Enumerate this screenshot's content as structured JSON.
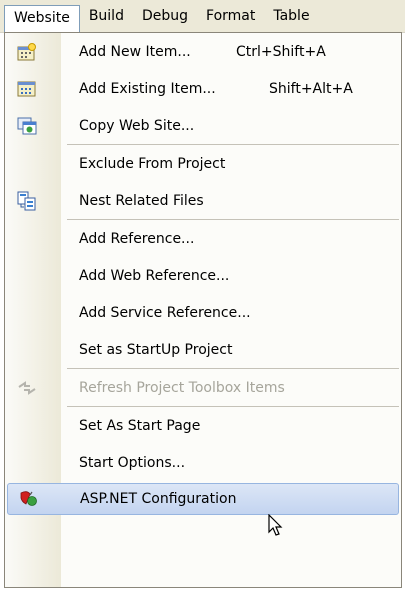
{
  "menubar": {
    "items": [
      {
        "label": "Website",
        "active": true
      },
      {
        "label": "Build"
      },
      {
        "label": "Debug"
      },
      {
        "label": "Format"
      },
      {
        "label": "Table"
      }
    ]
  },
  "menu": {
    "items": [
      {
        "label": "Add New Item...",
        "shortcut": "Ctrl+Shift+A",
        "icon": "new-item-icon"
      },
      {
        "label": "Add Existing Item...",
        "shortcut": "Shift+Alt+A",
        "icon": "existing-item-icon"
      },
      {
        "label": "Copy Web Site...",
        "icon": "copy-web-site-icon"
      },
      {
        "label": "Exclude From Project"
      },
      {
        "label": "Nest Related Files",
        "icon": "nest-files-icon"
      },
      {
        "label": "Add Reference..."
      },
      {
        "label": "Add Web Reference..."
      },
      {
        "label": "Add Service Reference..."
      },
      {
        "label": "Set as StartUp Project"
      },
      {
        "label": "Refresh Project Toolbox Items",
        "disabled": true,
        "icon": "refresh-toolbox-icon"
      },
      {
        "label": "Set As Start Page"
      },
      {
        "label": "Start Options..."
      },
      {
        "label": "ASP.NET Configuration",
        "selected": true,
        "icon": "asp-net-config-icon"
      }
    ]
  },
  "colors": {
    "menubar_bg": "#ece9d8",
    "highlight": "#c3d4f0",
    "disabled_text": "#a6a59b"
  }
}
